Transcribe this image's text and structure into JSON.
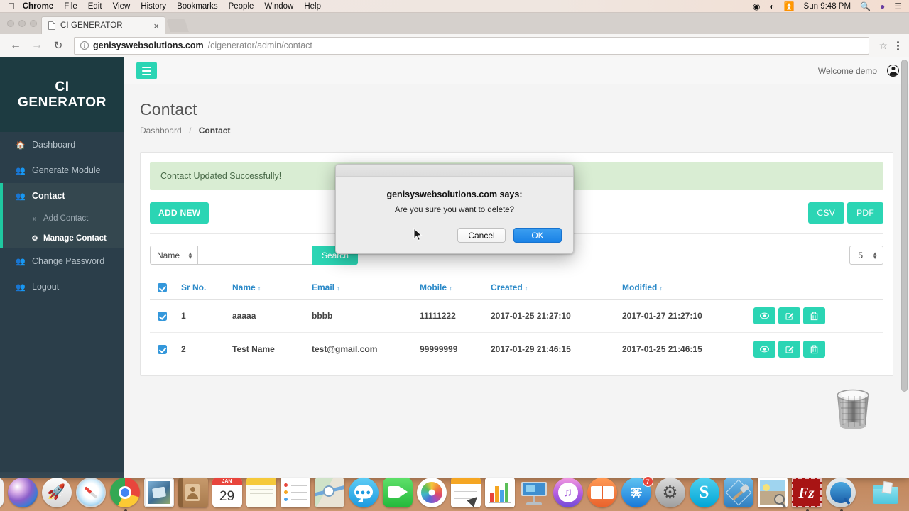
{
  "menubar": {
    "apple_icon": "apple-icon",
    "items": [
      {
        "label": "Chrome",
        "bold": true
      },
      {
        "label": "File",
        "bold": false
      },
      {
        "label": "Edit",
        "bold": false
      },
      {
        "label": "View",
        "bold": false
      },
      {
        "label": "History",
        "bold": false
      },
      {
        "label": "Bookmarks",
        "bold": false
      },
      {
        "label": "People",
        "bold": false
      },
      {
        "label": "Window",
        "bold": false
      },
      {
        "label": "Help",
        "bold": false
      }
    ],
    "status": {
      "record_icon": "screen-record-icon",
      "wifi_icon": "wifi-icon",
      "eject_icon": "eject-icon",
      "clock": "Sun 9:48 PM",
      "search_icon": "spotlight-search-icon",
      "siri_icon": "siri-icon",
      "notification_icon": "notification-center-icon"
    }
  },
  "browser": {
    "tab_title": "CI GENERATOR",
    "tab_close": "×",
    "back_icon": "back-arrow-icon",
    "forward_icon": "forward-arrow-icon",
    "reload_icon": "reload-icon",
    "url_host": "genisyswebsolutions.com",
    "url_path": "/cigenerator/admin/contact",
    "info_icon": "page-info-icon",
    "bookmark_icon": "star-bookmark-icon",
    "menu_icon": "chrome-menu-icon"
  },
  "sidebar": {
    "brand_line1": "CI",
    "brand_line2": "GENERATOR",
    "items": [
      {
        "label": "Dashboard",
        "icon": "home-icon"
      },
      {
        "label": "Generate Module",
        "icon": "users-icon"
      },
      {
        "label": "Contact",
        "icon": "users-icon",
        "active": true
      }
    ],
    "subitems": [
      {
        "label": "Add Contact",
        "icon": "chevron-double-right-icon"
      },
      {
        "label": "Manage Contact",
        "icon": "gear-icon",
        "current": true
      }
    ],
    "items_after": [
      {
        "label": "Change Password",
        "icon": "users-icon"
      },
      {
        "label": "Logout",
        "icon": "users-icon"
      }
    ]
  },
  "topbar": {
    "toggle_icon": "hamburger-menu-icon",
    "welcome": "Welcome demo",
    "avatar_icon": "user-avatar-icon"
  },
  "page": {
    "title": "Contact",
    "breadcrumb_root": "Dashboard",
    "breadcrumb_sep": "/",
    "breadcrumb_current": "Contact",
    "alert": "Contact Updated Successfully!",
    "add_new": "ADD NEW",
    "csv": "CSV",
    "pdf": "PDF",
    "search_field": "Name",
    "search_value": "",
    "search_placeholder": "",
    "search_button": "Search",
    "page_size": "5"
  },
  "table": {
    "columns": [
      {
        "label": "",
        "key": "chk",
        "sortable": false
      },
      {
        "label": "Sr No.",
        "key": "sr",
        "sortable": false
      },
      {
        "label": "Name",
        "key": "name",
        "sortable": true
      },
      {
        "label": "Email",
        "key": "email",
        "sortable": true
      },
      {
        "label": "Mobile",
        "key": "mobile",
        "sortable": true
      },
      {
        "label": "Created",
        "key": "created",
        "sortable": true
      },
      {
        "label": "Modified",
        "key": "modified",
        "sortable": true
      },
      {
        "label": "",
        "key": "actions",
        "sortable": false
      }
    ],
    "sort_icon": "sort-updown-icon",
    "rows": [
      {
        "checked": true,
        "sr": "1",
        "name": "aaaaa",
        "email": "bbbb",
        "mobile": "11111222",
        "created": "2017-01-25 21:27:10",
        "modified": "2017-01-27 21:27:10"
      },
      {
        "checked": true,
        "sr": "2",
        "name": "Test Name",
        "email": "test@gmail.com",
        "mobile": "99999999",
        "created": "2017-01-29 21:46:15",
        "modified": "2017-01-25 21:46:15"
      }
    ],
    "actions": [
      "view-eye-icon",
      "edit-pencil-icon",
      "delete-trash-icon"
    ]
  },
  "dialog": {
    "title": "genisyswebsolutions.com says:",
    "message": "Are you sure you want to delete?",
    "cancel": "Cancel",
    "ok": "OK"
  },
  "colors": {
    "teal_accent": "#2bd5b4",
    "sidebar_bg": "#2b3e4a",
    "sidebar_brand_bg": "#1d3b41",
    "sidebar_active_bg": "#34474f",
    "sidebar_marker": "#1fc8a0",
    "table_header_link": "#2a89c8",
    "checkbox_blue": "#3397db",
    "alert_bg": "#d9edd3",
    "alert_text": "#4a6b49",
    "ok_button_blue": "#1a82e6"
  },
  "dock": {
    "items": [
      {
        "name": "finder",
        "running": true
      },
      {
        "name": "siri",
        "running": false
      },
      {
        "name": "launchpad",
        "running": false
      },
      {
        "name": "safari",
        "running": false
      },
      {
        "name": "google-chrome",
        "running": true
      },
      {
        "name": "mail",
        "running": false
      },
      {
        "name": "contacts",
        "running": false
      },
      {
        "name": "calendar",
        "running": false,
        "label": "JAN",
        "day": "29"
      },
      {
        "name": "notes",
        "running": false
      },
      {
        "name": "reminders",
        "running": false
      },
      {
        "name": "maps",
        "running": false
      },
      {
        "name": "messages",
        "running": false
      },
      {
        "name": "facetime",
        "running": false
      },
      {
        "name": "photos",
        "running": false
      },
      {
        "name": "pages",
        "running": false
      },
      {
        "name": "numbers",
        "running": false
      },
      {
        "name": "keynote",
        "running": false
      },
      {
        "name": "itunes",
        "running": false
      },
      {
        "name": "ibooks",
        "running": false
      },
      {
        "name": "app-store",
        "running": false,
        "badge": "7"
      },
      {
        "name": "system-preferences",
        "running": false
      },
      {
        "name": "skype",
        "running": false
      },
      {
        "name": "xcode",
        "running": false
      },
      {
        "name": "preview",
        "running": false
      },
      {
        "name": "filezilla",
        "running": true
      },
      {
        "name": "quicktime",
        "running": true
      },
      {
        "name": "downloads-folder",
        "running": false
      },
      {
        "name": "trash",
        "running": false
      }
    ]
  }
}
